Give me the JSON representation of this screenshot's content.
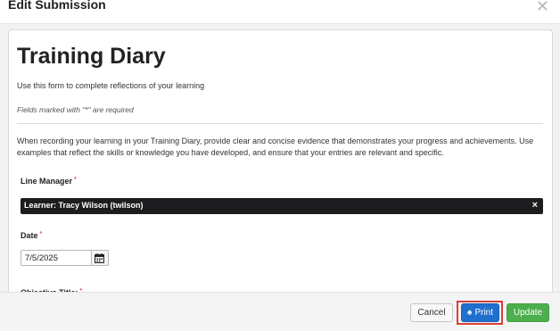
{
  "modal": {
    "title": "Edit Submission",
    "close_icon": "close-icon"
  },
  "form": {
    "title": "Training Diary",
    "subtitle": "Use this form to complete reflections of your learning",
    "required_note": "Fields marked with \"*\" are required",
    "instructions": "When recording your learning in your Training Diary, provide clear and concise evidence that demonstrates your progress and achievements. Use examples that reflect the skills or knowledge you have developed, and ensure that your entries are relevant and specific."
  },
  "fields": {
    "line_manager": {
      "label": "Line Manager",
      "required_mark": "*",
      "selected_value": "Learner: Tracy Wilson (twilson)",
      "clear_label": "×"
    },
    "date": {
      "label": "Date",
      "required_mark": "*",
      "value": "7/5/2025",
      "icon": "calendar-icon"
    },
    "objective_title": {
      "label": "Objective Title:",
      "required_mark": "*"
    }
  },
  "footer": {
    "cancel_label": "Cancel",
    "print_label": "Print",
    "print_icon": "printer-icon",
    "update_label": "Update",
    "colors": {
      "print": "#1f6fcf",
      "update": "#4cae4c",
      "highlight": "#d9403a"
    }
  }
}
